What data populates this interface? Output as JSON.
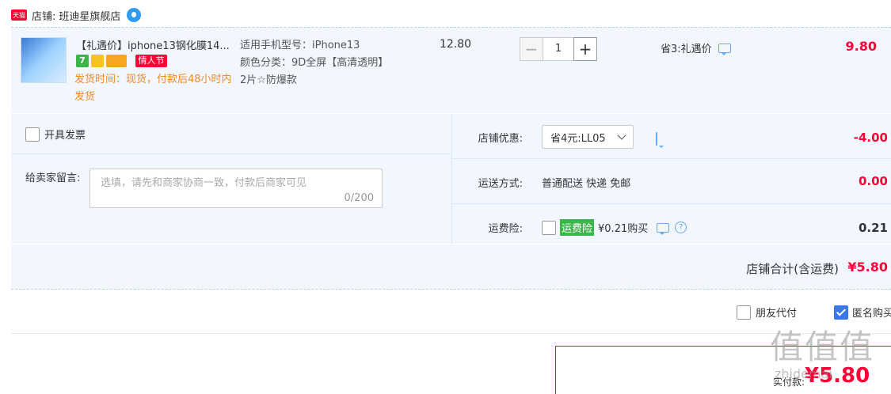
{
  "store": {
    "badge": "天猫",
    "label": "店铺:",
    "name": "班迪星旗舰店"
  },
  "item": {
    "title": "【礼遇价】iphone13钢化膜14...",
    "tag_seven": "7",
    "tag_festival": "情人节",
    "ship_time": "发货时间：现货，付款后48小时内发货",
    "sku_model": "适用手机型号：iPhone13",
    "sku_color": "颜色分类：9D全屏【高清透明】",
    "sku_extra": "2片☆防爆款",
    "unit_price": "12.80",
    "qty_minus": "−",
    "qty": "1",
    "qty_plus": "+",
    "promo": "省3:礼遇价",
    "total": "9.80"
  },
  "options": {
    "invoice_label": "开具发票",
    "message_label": "给卖家留言:",
    "message_placeholder": "选填，请先和商家协商一致，付款后商家可见",
    "message_count": "0/200",
    "discount_label": "店铺优惠:",
    "discount_selected": "省4元:LL05",
    "discount_amount": "-4.00",
    "shipping_label": "运送方式:",
    "shipping_value": "普通配送 快递 免邮",
    "shipping_amount": "0.00",
    "insurance_label": "运费险:",
    "insurance_tag": "运费险",
    "insurance_price": "¥0.21购买",
    "insurance_help": "?",
    "insurance_amount": "0.21"
  },
  "store_total": {
    "label": "店铺合计(含运费)",
    "value": "¥5.80"
  },
  "bottom": {
    "friend_pay": "朋友代付",
    "anonymous": "匿名购买"
  },
  "checkout": {
    "label": "实付款:",
    "value": "¥5.80"
  },
  "watermark": {
    "main": "值值值",
    "sub": "zhidemai"
  },
  "colors": {
    "price_red": "#ff0036",
    "panel_bg": "#f2f7ff",
    "accent_blue": "#3b78e7",
    "ship_orange": "#f08a24"
  }
}
